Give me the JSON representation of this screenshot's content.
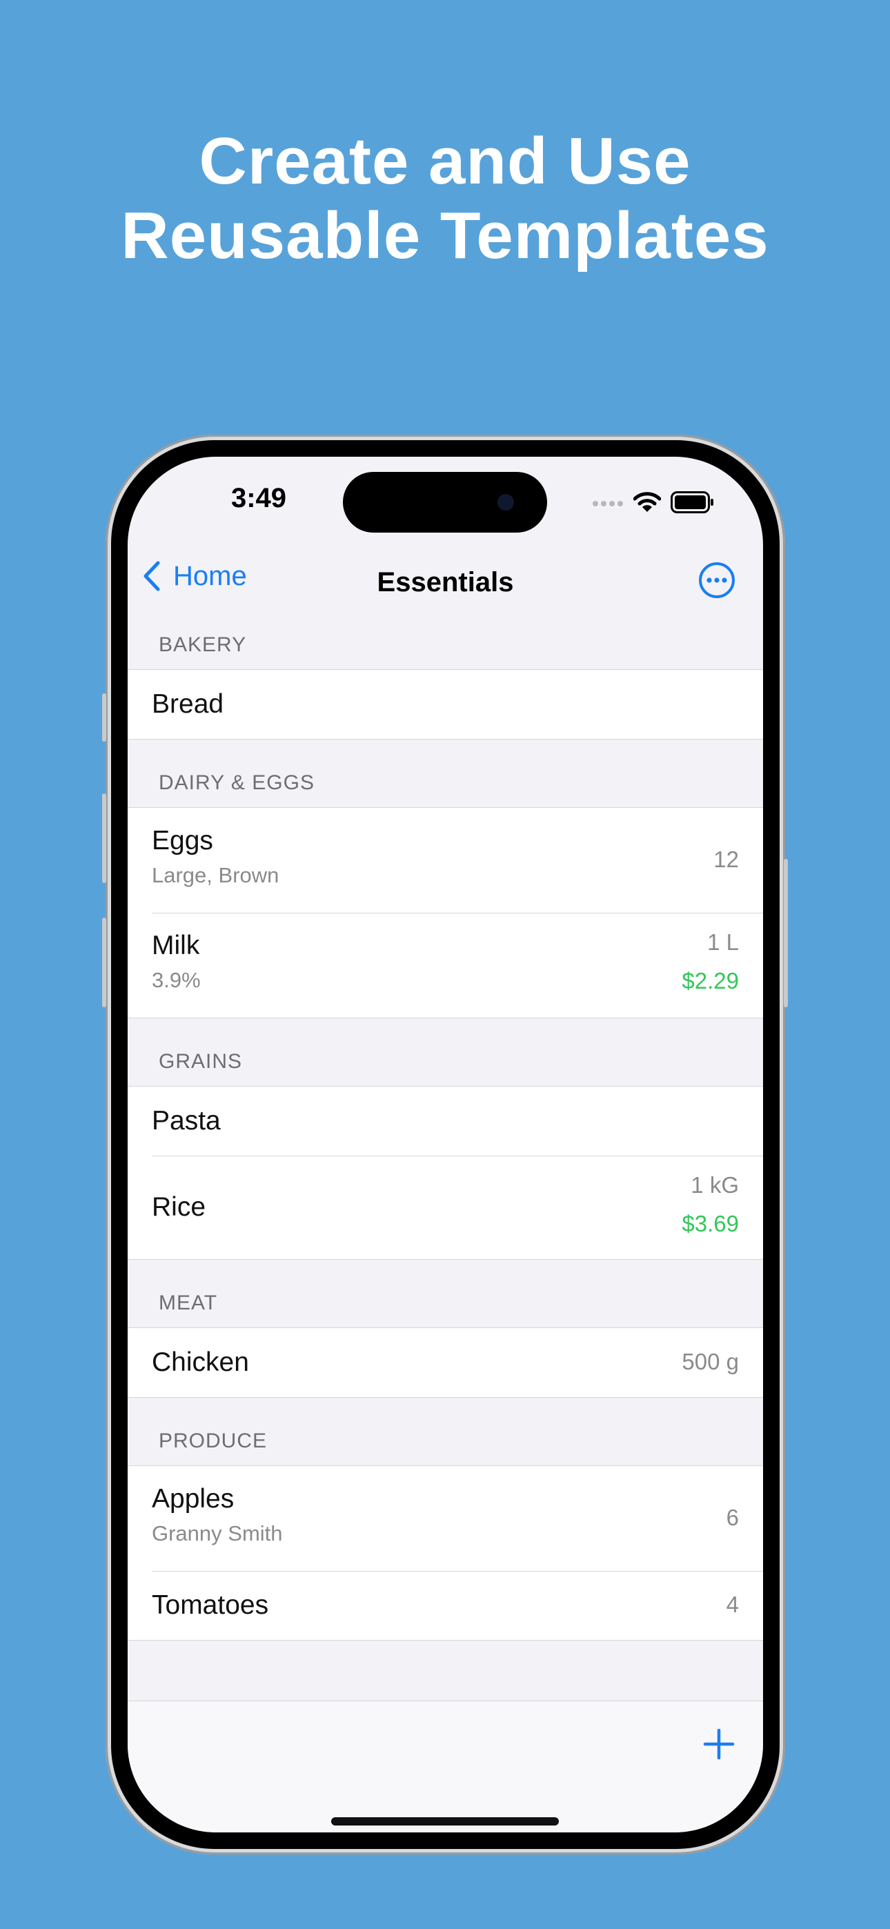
{
  "headline": {
    "line1": "Create and Use",
    "line2": "Reusable Templates"
  },
  "status": {
    "time": "3:49"
  },
  "nav": {
    "back_label": "Home",
    "title": "Essentials"
  },
  "colors": {
    "accent": "#1A7EF2",
    "price": "#33C759",
    "background": "#58A2DA"
  },
  "sections": [
    {
      "header": "BAKERY",
      "items": [
        {
          "name": "Bread"
        }
      ]
    },
    {
      "header": "DAIRY & EGGS",
      "items": [
        {
          "name": "Eggs",
          "note": "Large, Brown",
          "quantity": "12"
        },
        {
          "name": "Milk",
          "note": "3.9%",
          "quantity": "1 L",
          "price": "$2.29"
        }
      ]
    },
    {
      "header": "GRAINS",
      "items": [
        {
          "name": "Pasta"
        },
        {
          "name": "Rice",
          "quantity": "1 kG",
          "price": "$3.69"
        }
      ]
    },
    {
      "header": "MEAT",
      "items": [
        {
          "name": "Chicken",
          "quantity": "500 g"
        }
      ]
    },
    {
      "header": "PRODUCE",
      "items": [
        {
          "name": "Apples",
          "note": "Granny Smith",
          "quantity": "6"
        },
        {
          "name": "Tomatoes",
          "quantity": "4"
        }
      ]
    }
  ],
  "icons": {
    "back": "chevron-left-icon",
    "more": "ellipsis-circle-icon",
    "add": "plus-icon",
    "wifi": "wifi-icon",
    "battery": "battery-icon"
  }
}
